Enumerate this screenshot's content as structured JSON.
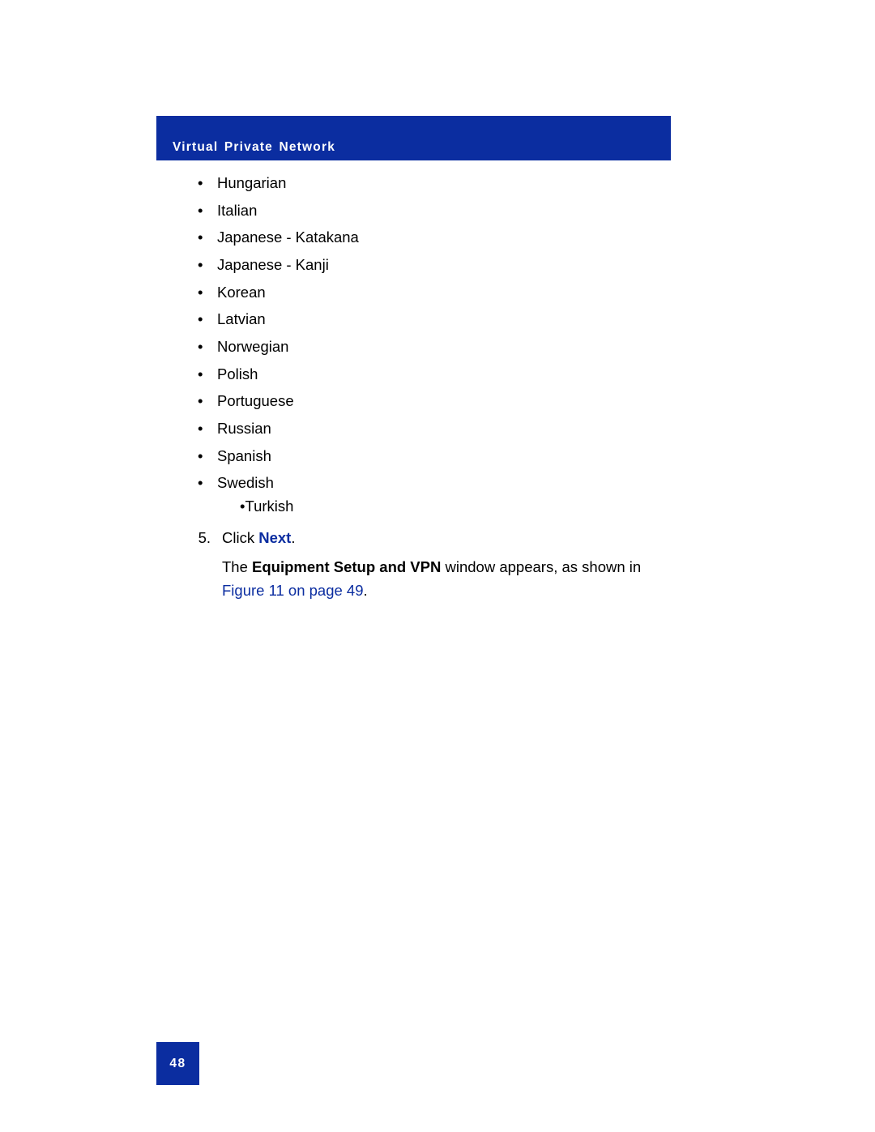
{
  "header": {
    "title": "Virtual Private Network"
  },
  "languages": [
    "Hungarian",
    "Italian",
    "Japanese - Katakana",
    "Japanese - Kanji",
    "Korean",
    "Latvian",
    "Norwegian",
    "Polish",
    "Portuguese",
    "Russian",
    "Spanish",
    "Swedish"
  ],
  "languages_sub": "•Turkish",
  "step": {
    "number": "5.",
    "action_prefix": "Click ",
    "action_link": "Next",
    "action_suffix": ".",
    "result_prefix": "The ",
    "result_bold": "Equipment Setup and VPN",
    "result_mid": " window appears, as shown in ",
    "result_xref": "Figure 11 on page 49",
    "result_suffix": "."
  },
  "page_number": "48"
}
